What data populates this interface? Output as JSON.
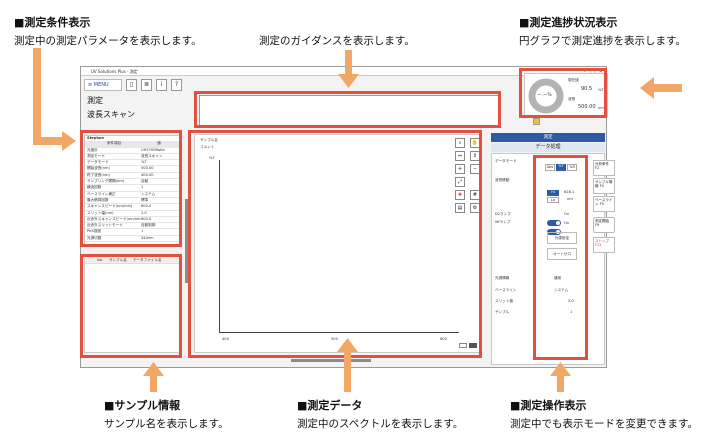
{
  "annotations": {
    "conditions": {
      "title": "■測定条件表示",
      "desc": "測定中の測定パラメータを表示します。"
    },
    "guidance": {
      "desc": "測定のガイダンスを表示します。"
    },
    "progress": {
      "title": "■測定進捗状況表示",
      "desc": "円グラフで測定進捗を表示します。"
    },
    "sample": {
      "title": "■サンプル情報",
      "desc": "サンプル名を表示します。"
    },
    "data": {
      "title": "■測定データ",
      "desc": "測定中のスペクトルを表示します。"
    },
    "operation": {
      "title": "■測定操作表示",
      "desc": "測定中でも表示モードを変更できます。"
    }
  },
  "app": {
    "title": "UV Solutions Plus - 測定",
    "menu_label": "≡ MENU",
    "mode_title": "測定",
    "mode_sub": "波長スキャン",
    "progress": {
      "center": "ー.ー%",
      "label1": "現在値",
      "value1": "90.5",
      "unit1": "%T",
      "label2": "波長",
      "value2": "500.00",
      "unit2": "nm"
    },
    "conditions": {
      "header": "Stepbue",
      "col1": "条件項目",
      "col2": "値",
      "rows": [
        {
          "k": "光度計",
          "v": "UH5700Ratio"
        },
        {
          "k": "測定モード",
          "v": "波長スキャン"
        },
        {
          "k": "データモード",
          "v": "%T"
        },
        {
          "k": "開始波長(nm)",
          "v": "500.00"
        },
        {
          "k": "終了波長(nm)",
          "v": "400.00"
        },
        {
          "k": "サンプリング間隔(nm)",
          "v": "自動"
        },
        {
          "k": "繰返回数",
          "v": "1"
        },
        {
          "k": "ベースライン補正",
          "v": "システム"
        },
        {
          "k": "最大積算回数",
          "v": "標準"
        },
        {
          "k": "スキャンスピード(nm/min)",
          "v": "600.0"
        },
        {
          "k": "スリット幅(nm)",
          "v": "2.0"
        },
        {
          "k": "近赤外スキャンスピード(nm/min)",
          "v": "600.0"
        },
        {
          "k": "近赤外スリットモード",
          "v": "自動制御"
        },
        {
          "k": "PbS感度",
          "v": "1"
        },
        {
          "k": "光源切替",
          "v": "340nm"
        }
      ]
    },
    "sample": {
      "col_no": "No.",
      "col_name": "サンプル名",
      "col_file": "データファイル名"
    },
    "graph": {
      "title": "サンプル名",
      "subtitle": "コメント",
      "ylabel": "%T",
      "x_ticks": [
        "400",
        "500",
        "600"
      ]
    },
    "right": {
      "tab": "測定",
      "section": "データ処理",
      "data_mode_label": "データモード",
      "data_modes": [
        "Abs",
        "%T",
        "%R"
      ],
      "wavelength_label": "波長移動",
      "wl_buttons": [
        "Hi",
        "Lo"
      ],
      "wl_values": [
        "628.1",
        "nm"
      ],
      "d2_label": "D2ランプ",
      "wi_label": "WIランプ",
      "on1": "On",
      "on2": "On",
      "lamp_settings": "光源設定",
      "auto_zero": "オートゼロ",
      "info_header": "光源情報",
      "info": [
        {
          "k": "ベースライン",
          "v": "システム"
        },
        {
          "k": "スリット値",
          "v": "2.0"
        },
        {
          "k": "サンプル",
          "v": "1"
        }
      ],
      "top_extra": "通常",
      "side_buttons": [
        "分析条件 F2",
        "サンプル情報 F4",
        "ベースライン F5",
        "測定開始 F9",
        "ストップ F12"
      ]
    }
  }
}
